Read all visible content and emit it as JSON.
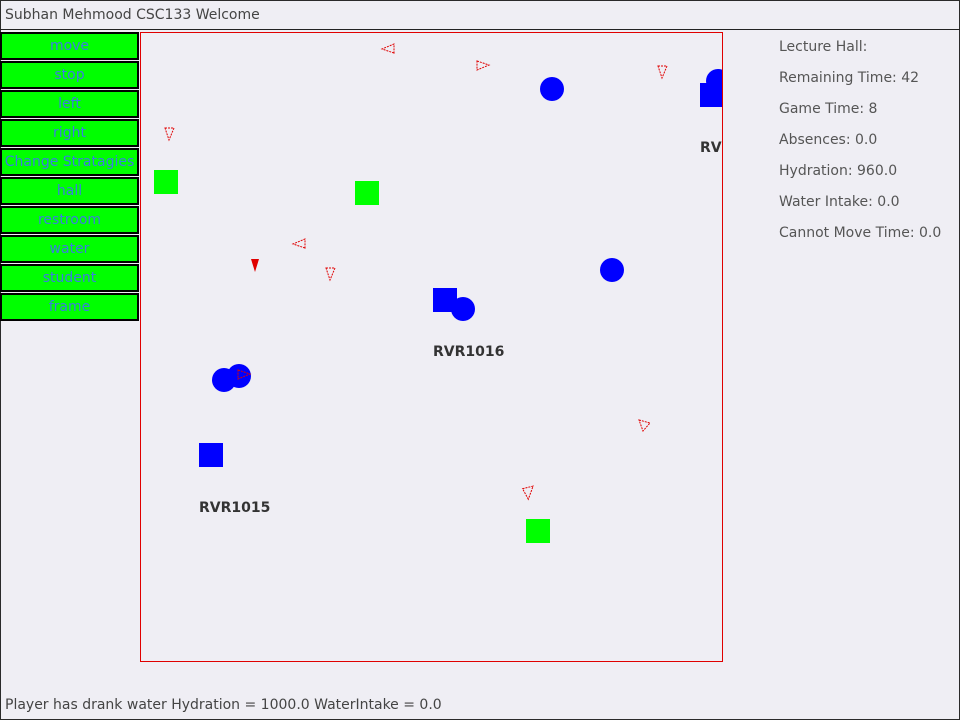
{
  "window": {
    "title": "Subhan Mehmood CSC133 Welcome"
  },
  "commands": [
    {
      "label": "move"
    },
    {
      "label": "stop"
    },
    {
      "label": "left"
    },
    {
      "label": "right"
    },
    {
      "label": "Change Stratagies"
    },
    {
      "label": "hall"
    },
    {
      "label": "restroom"
    },
    {
      "label": "water"
    },
    {
      "label": "student"
    },
    {
      "label": "frame"
    }
  ],
  "map": {
    "labels": {
      "lecture_hall_a": "RVR1015",
      "lecture_hall_b": "RVR1016",
      "lecture_hall_c": "RVI"
    }
  },
  "stats": {
    "lecture_hall": "Lecture Hall:",
    "remaining_time": "Remaining Time: 42",
    "game_time": "Game Time: 8",
    "absences": "Absences: 0.0",
    "hydration": "Hydration: 960.0",
    "water_intake": "Water Intake: 0.0",
    "cannot_move_time": "Cannot Move Time: 0.0"
  },
  "status_message": "Player has drank water Hydration = 1000.0 WaterIntake = 0.0",
  "colors": {
    "button_bg": "#00ff00",
    "button_text": "#3b7de0",
    "map_border": "#e00000",
    "student": "#0000ff",
    "water_dispenser": "#00ff00",
    "player": "#e00000"
  }
}
